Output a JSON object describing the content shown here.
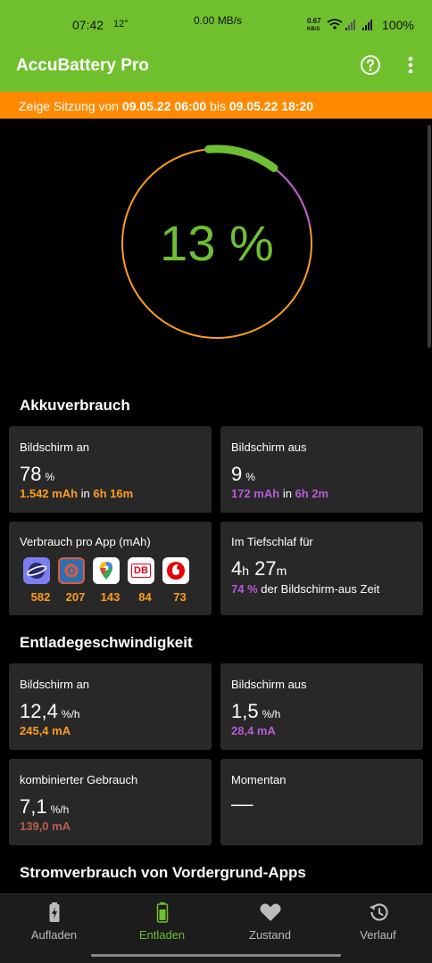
{
  "status_bar": {
    "time": "07:42",
    "temperature": "12°",
    "net_speed": "0.00 MB/s",
    "net_speed2": "0.67",
    "net_speed2_unit": "KB/S",
    "battery": "100%"
  },
  "app_bar": {
    "title": "AccuBattery Pro",
    "help_icon": "help-circle-icon",
    "more_icon": "more-vert-icon"
  },
  "banner": {
    "prefix": "Zeige Sitzung von ",
    "from": "09.05.22 06:00",
    "middle": " bis ",
    "to": "09.05.22 18:20",
    "color": "#ff8a00"
  },
  "gauge": {
    "value_text": "13 %",
    "percent": 13,
    "colors": {
      "ring": "#ff9d1c",
      "fill": "#6ebf33",
      "accent": "#b85bd6"
    }
  },
  "sections": {
    "usage": "Akkuverbrauch",
    "discharge_speed": "Entladegeschwindigkeit",
    "foreground": "Stromverbrauch von Vordergrund-Apps"
  },
  "usage": {
    "screen_on": {
      "label": "Bildschirm an",
      "value": "78",
      "unit": "%",
      "mah": "1.542 mAh",
      "in": " in ",
      "duration": "6h 16m"
    },
    "screen_off": {
      "label": "Bildschirm aus",
      "value": "9",
      "unit": "%",
      "mah": "172 mAh",
      "in": " in ",
      "duration": "6h 2m"
    },
    "per_app": {
      "label": "Verbrauch pro App (mAh)",
      "apps": [
        {
          "icon": "samsung-internet-icon",
          "value": "582"
        },
        {
          "icon": "settings-app-icon",
          "value": "207"
        },
        {
          "icon": "google-maps-icon",
          "value": "143"
        },
        {
          "icon": "db-navigator-icon",
          "value": "84"
        },
        {
          "icon": "vodafone-icon",
          "value": "73"
        }
      ],
      "db_logo": "DB"
    },
    "deep_sleep": {
      "label": "Im Tiefschlaf für",
      "hours": "4",
      "h_unit": "h",
      "minutes": "27",
      "m_unit": "m",
      "pct": "74 %",
      "pct_suffix": " der Bildschirm-aus Zeit"
    }
  },
  "discharge": {
    "screen_on": {
      "label": "Bildschirm an",
      "value": "12,4",
      "unit": "%/h",
      "ma": "245,4 mA"
    },
    "screen_off": {
      "label": "Bildschirm aus",
      "value": "1,5",
      "unit": "%/h",
      "ma": "28,4 mA"
    },
    "combined": {
      "label": "kombinierter Gebrauch",
      "value": "7,1",
      "unit": "%/h",
      "ma": "139,0 mA"
    },
    "current": {
      "label": "Momentan",
      "value": "––"
    }
  },
  "bottom_nav": [
    {
      "label": "Aufladen",
      "icon": "battery-charging-icon",
      "active": false
    },
    {
      "label": "Entladen",
      "icon": "battery-discharging-icon",
      "active": true
    },
    {
      "label": "Zustand",
      "icon": "heart-icon",
      "active": false
    },
    {
      "label": "Verlauf",
      "icon": "history-icon",
      "active": false
    }
  ]
}
